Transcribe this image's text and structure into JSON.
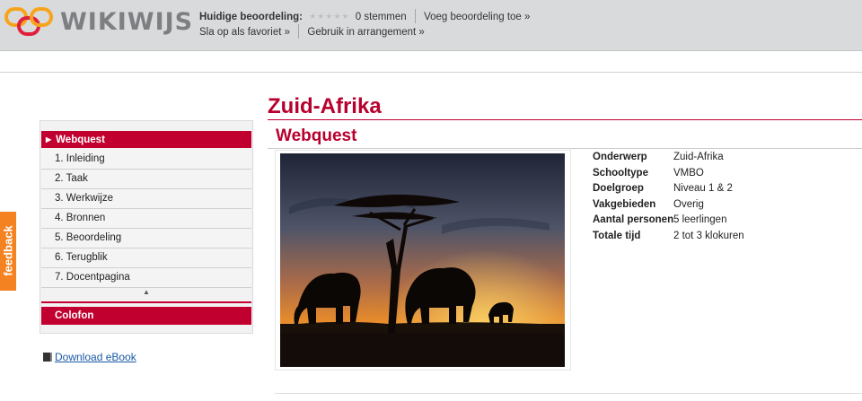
{
  "header": {
    "brand": "WIKIWIJS",
    "rating_label": "Huidige beoordeling:",
    "rating_stars": 0,
    "rating_count": "0 stemmen",
    "add_rating": "Voeg beoordeling toe »",
    "save_favorite": "Sla op als favoriet »",
    "use_arrangement": "Gebruik in arrangement »"
  },
  "feedback_tab": "feedback",
  "sidebar": {
    "header": "Webquest",
    "items": [
      {
        "label": "1. Inleiding"
      },
      {
        "label": "2. Taak"
      },
      {
        "label": "3. Werkwijze"
      },
      {
        "label": "4. Bronnen"
      },
      {
        "label": "5. Beoordeling"
      },
      {
        "label": "6. Terugblik"
      },
      {
        "label": "7. Docentpagina"
      }
    ],
    "colofon": "Colofon"
  },
  "download_label": "Download eBook",
  "main": {
    "title": "Zuid-Afrika",
    "subtitle": "Webquest",
    "info": [
      {
        "key": "Onderwerp",
        "value": "Zuid-Afrika"
      },
      {
        "key": "Schooltype",
        "value": "VMBO"
      },
      {
        "key": "Doelgroep",
        "value": "Niveau 1 & 2"
      },
      {
        "key": "Vakgebieden",
        "value": "Overig"
      },
      {
        "key": "Aantal personen",
        "value": "5 leerlingen"
      },
      {
        "key": "Totale tijd",
        "value": "2 tot 3 klokuren"
      }
    ]
  },
  "colors": {
    "accent": "#c1002f",
    "topbar": "#d9dadb",
    "feedback": "#f58220",
    "link": "#1a5aa6"
  },
  "icons": [
    "wikiwijs-logo-icon",
    "star-icon",
    "arrow-right-icon",
    "book-icon",
    "caret-up-icon"
  ]
}
